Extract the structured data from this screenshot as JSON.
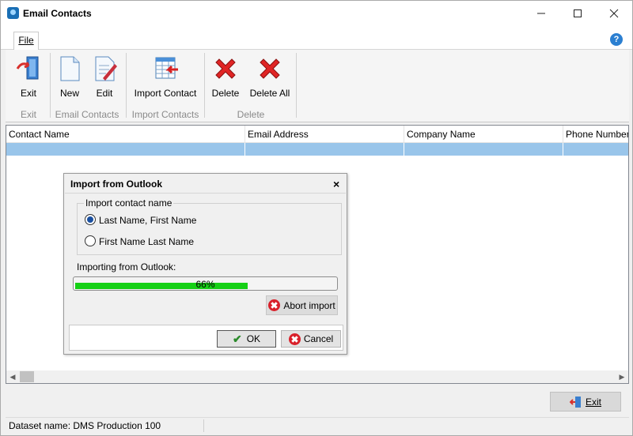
{
  "window": {
    "title": "Email Contacts"
  },
  "ribbon": {
    "file_tab": "File",
    "buttons": {
      "exit": "Exit",
      "new": "New",
      "edit": "Edit",
      "import_contact": "Import Contact",
      "delete": "Delete",
      "delete_all": "Delete All"
    },
    "groups": {
      "exit": "Exit",
      "email_contacts": "Email Contacts",
      "import_contacts": "Import Contacts",
      "delete": "Delete"
    }
  },
  "grid": {
    "columns": [
      "Contact Name",
      "Email Address",
      "Company Name",
      "Phone Number"
    ]
  },
  "dialog": {
    "title": "Import from Outlook",
    "close_glyph": "×",
    "group_label": "Import contact name",
    "options": [
      "Last Name, First Name",
      "First Name Last Name"
    ],
    "selected_option": 0,
    "importing_label": "Importing from Outlook:",
    "progress_percent": 66,
    "progress_text": "66%",
    "abort_label": "Abort import",
    "ok_label": "OK",
    "cancel_label": "Cancel"
  },
  "footer": {
    "exit_label": "Exit",
    "status_text": "Dataset name:  DMS Production 100"
  },
  "icons": {
    "app": "app-icon",
    "help": "help-icon",
    "exit": "door-exit-icon",
    "new": "new-document-icon",
    "edit": "edit-document-icon",
    "import": "import-table-icon",
    "delete": "red-x-icon"
  },
  "colors": {
    "selection_row": "#99c5ea",
    "progress": "#16d016",
    "delete_red": "#d9202a"
  }
}
